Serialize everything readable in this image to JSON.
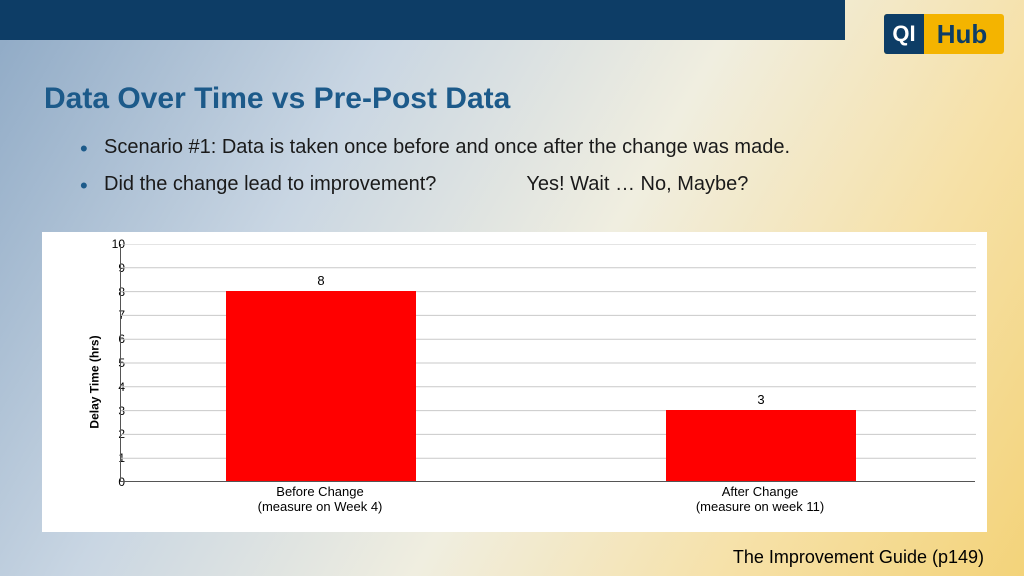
{
  "logo": {
    "qi": "QI",
    "hub": "Hub"
  },
  "title": "Data Over Time vs Pre-Post Data",
  "bullets": {
    "b1": "Scenario #1: Data is taken once before and once after the change was made.",
    "b2a": "Did the change lead to improvement?",
    "b2b": "Yes! Wait … No, Maybe?"
  },
  "footer": "The Improvement Guide (p149)",
  "chart_data": {
    "type": "bar",
    "title": "",
    "xlabel": "",
    "ylabel": "Delay Time (hrs)",
    "ylim": [
      0,
      10
    ],
    "yticks": [
      0,
      1,
      2,
      3,
      4,
      5,
      6,
      7,
      8,
      9,
      10
    ],
    "categories": [
      "Before Change",
      "After Change"
    ],
    "category_sub": [
      "(measure on Week 4)",
      "(measure on week 11)"
    ],
    "values": [
      8,
      3
    ],
    "bar_color": "#ff0000"
  },
  "ticks": {
    "t0": "0",
    "t1": "1",
    "t2": "2",
    "t3": "3",
    "t4": "4",
    "t5": "5",
    "t6": "6",
    "t7": "7",
    "t8": "8",
    "t9": "9",
    "t10": "10"
  },
  "bars": {
    "v0": "8",
    "v1": "3",
    "c0a": "Before Change",
    "c0b": "(measure on Week 4)",
    "c1a": "After Change",
    "c1b": "(measure on week 11)"
  }
}
